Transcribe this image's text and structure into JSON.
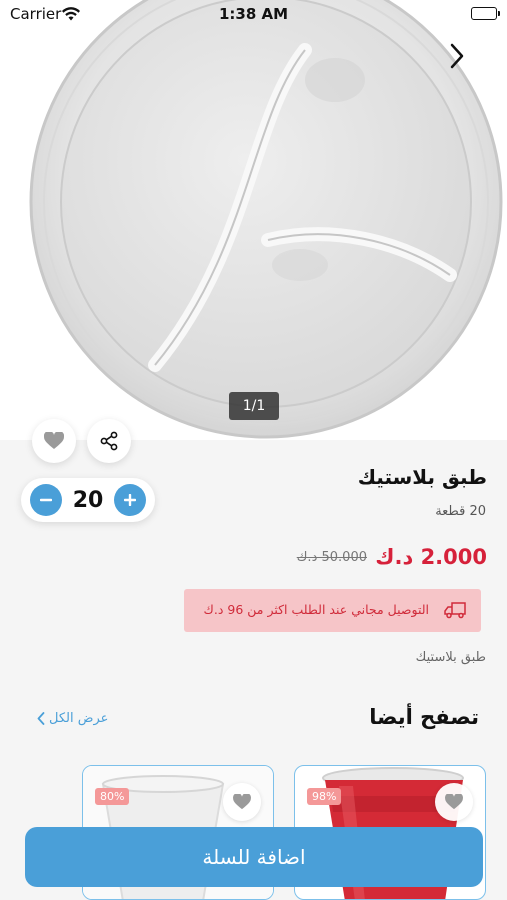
{
  "status_bar": {
    "carrier": "Carrier",
    "time": "1:38 AM"
  },
  "gallery": {
    "pager": "1/1"
  },
  "product": {
    "title": "طبق بلاستيك",
    "pieces": "20 قطعة",
    "price": "2.000 د.ك",
    "old_price": "50.000 د.ك",
    "quantity": "20",
    "description": "طبق بلاستيك"
  },
  "delivery": {
    "text": "التوصيل مجاني عند الطلب اكثر من 96 د.ك"
  },
  "related": {
    "title": "تصفح أيضا",
    "view_all": "عرض الكل",
    "items": [
      {
        "discount": "98%"
      },
      {
        "discount": "80%"
      }
    ]
  },
  "cart": {
    "add_label": "اضافة للسلة"
  },
  "colors": {
    "accent": "#4a9fd8",
    "price_red": "#d6213a",
    "notice_bg": "#f6c5c8"
  }
}
